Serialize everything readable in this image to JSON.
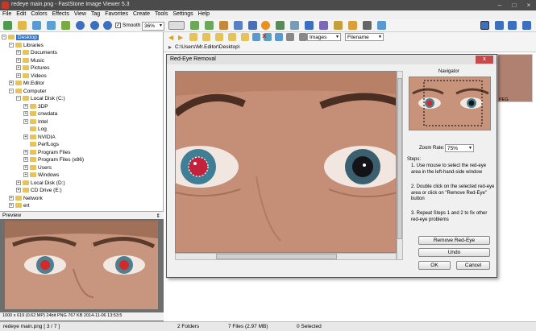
{
  "window": {
    "title": "redeye main.png  -  FastStone Image Viewer 5.3"
  },
  "menu": [
    "File",
    "Edit",
    "Colors",
    "Effects",
    "View",
    "Tag",
    "Favorites",
    "Create",
    "Tools",
    "Settings",
    "Help"
  ],
  "toolbar": {
    "smooth_label": "Smooth",
    "smooth_checked": "✓",
    "zoom_value": "36%"
  },
  "tree": {
    "items": [
      {
        "label": "Desktop",
        "level": 0,
        "expander": "−",
        "selected": true
      },
      {
        "label": "Libraries",
        "level": 1,
        "expander": "−"
      },
      {
        "label": "Documents",
        "level": 2,
        "expander": "+"
      },
      {
        "label": "Music",
        "level": 2,
        "expander": "+"
      },
      {
        "label": "Pictures",
        "level": 2,
        "expander": "+"
      },
      {
        "label": "Videos",
        "level": 2,
        "expander": "+"
      },
      {
        "label": "Mr.Editor",
        "level": 1,
        "expander": "+"
      },
      {
        "label": "Computer",
        "level": 1,
        "expander": "−"
      },
      {
        "label": "Local Disk (C:)",
        "level": 2,
        "expander": "−"
      },
      {
        "label": "3DP",
        "level": 3,
        "expander": "+"
      },
      {
        "label": "cnwdata",
        "level": 3,
        "expander": "+"
      },
      {
        "label": "Intel",
        "level": 3,
        "expander": "+"
      },
      {
        "label": "Log",
        "level": 3,
        "expander": ""
      },
      {
        "label": "NVIDIA",
        "level": 3,
        "expander": "+"
      },
      {
        "label": "PerfLogs",
        "level": 3,
        "expander": ""
      },
      {
        "label": "Program Files",
        "level": 3,
        "expander": "+"
      },
      {
        "label": "Program Files (x86)",
        "level": 3,
        "expander": "+"
      },
      {
        "label": "Users",
        "level": 3,
        "expander": "+"
      },
      {
        "label": "Windows",
        "level": 3,
        "expander": "+"
      },
      {
        "label": "Local Disk (D:)",
        "level": 2,
        "expander": "+"
      },
      {
        "label": "CD Drive (E:)",
        "level": 2,
        "expander": "+"
      },
      {
        "label": "Network",
        "level": 1,
        "expander": "+"
      },
      {
        "label": "ert",
        "level": 1,
        "expander": "+"
      }
    ]
  },
  "preview": {
    "header": "Preview",
    "info": "1000 x 619 (0.62 MP)  24bit  PNG   767 KB   2014-11-06 13:53:5",
    "pin": "⇕"
  },
  "browser": {
    "address": "C:\\Users\\Mr.Editor\\Desktop\\",
    "filter": "Images",
    "sort": "Filename"
  },
  "dialog": {
    "title": "Red-Eye Removal",
    "navigator_label": "Navigator",
    "zoom_label": "Zoom Rate:",
    "zoom_value": "75%",
    "steps_heading": "Steps:",
    "step1": "1. Use mouse to select the red-eye area in the left-hand-side window",
    "step2": "2. Double click on the selected red-eye area or click on \"Remove Red-Eye\" button",
    "step3": "3. Repeat Steps 1 and 2 to fix other red-eye problems",
    "remove_label": "Remove Red-Eye",
    "undo_label": "Undo",
    "ok_label": "OK",
    "cancel_label": "Cancel",
    "close_label": "x"
  },
  "status": {
    "file": "redeye main.png [ 3 / 7 ]",
    "folders": "2 Folders",
    "files": "7 Files (2.97 MB)",
    "selected": "0 Selected"
  },
  "thumb_label": "PEG"
}
